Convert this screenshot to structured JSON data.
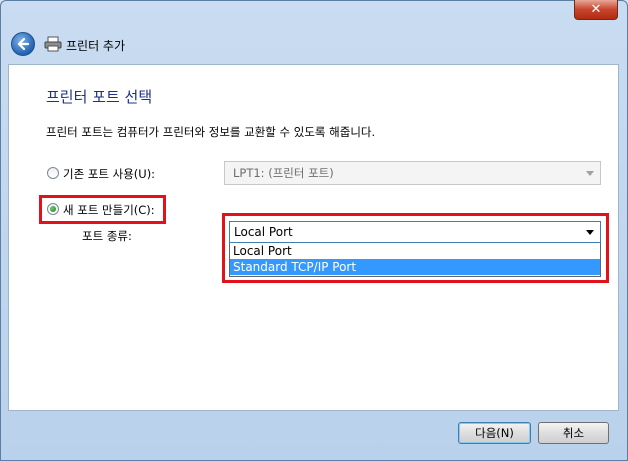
{
  "window": {
    "title": "프린터 추가",
    "close_glyph": "✕"
  },
  "page": {
    "heading": "프린터 포트 선택",
    "description": "프린터 포트는 컴퓨터가 프린터와 정보를 교환할 수 있도록 해줍니다."
  },
  "options": {
    "existing_port": {
      "label": "기존 포트 사용(U):",
      "checked": false,
      "value": "LPT1: (프린터 포트)"
    },
    "new_port": {
      "label": "새 포트 만들기(C):",
      "checked": true
    },
    "port_type": {
      "label": "포트 종류:",
      "selected": "Local Port",
      "items": [
        "Local Port",
        "Standard TCP/IP Port"
      ],
      "highlighted_index": 1
    }
  },
  "buttons": {
    "next": "다음(N)",
    "cancel": "취소"
  },
  "colors": {
    "highlight": "#e2121b",
    "heading": "#1e3287",
    "selection": "#3399ff"
  },
  "icons": {
    "back": "back-arrow-icon",
    "printer": "printer-icon"
  }
}
